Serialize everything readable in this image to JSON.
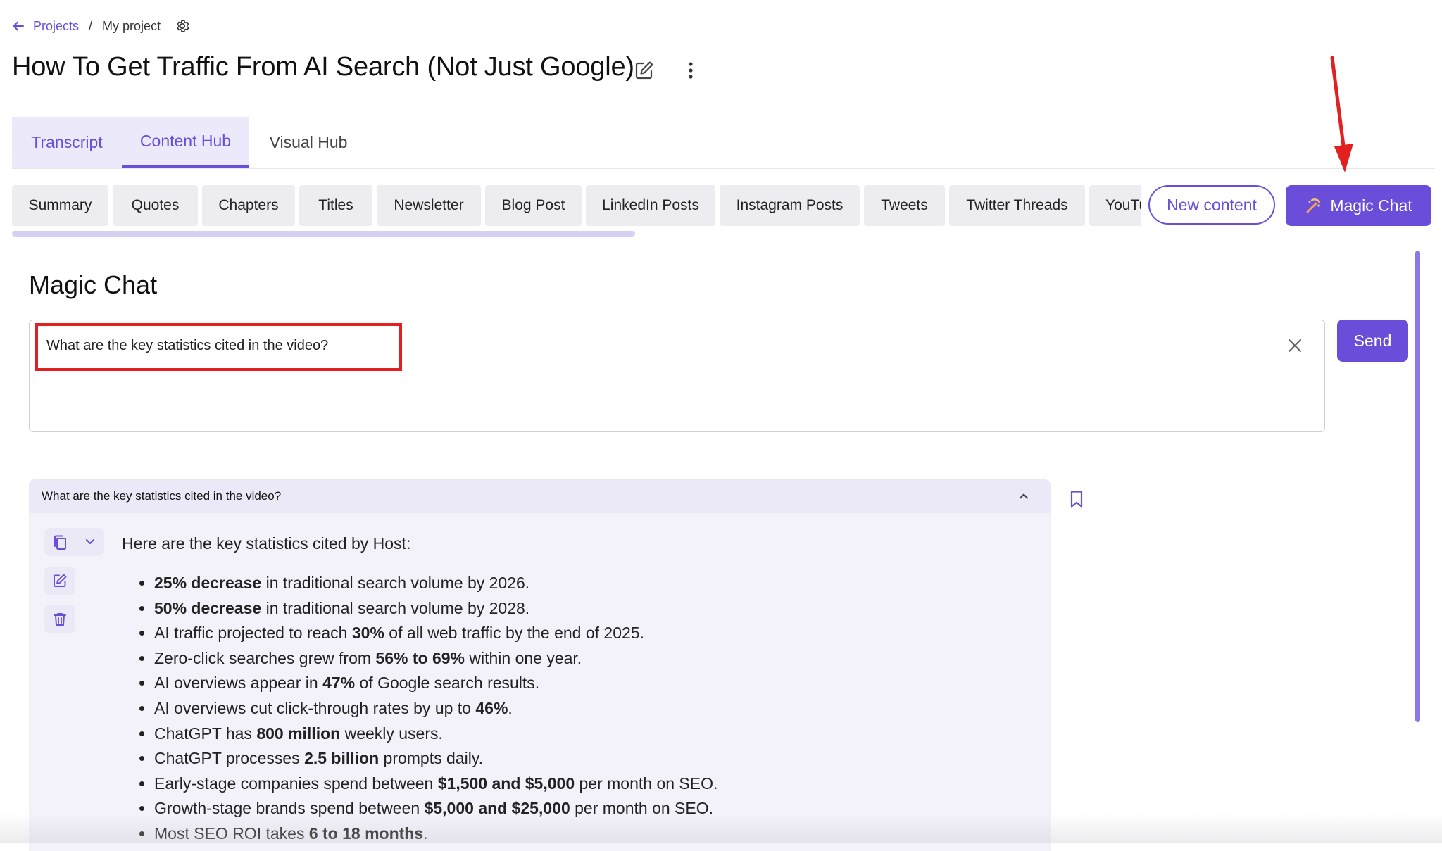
{
  "breadcrumb": {
    "back_icon": "arrow-left-icon",
    "projects": "Projects",
    "separator": "/",
    "current": "My project",
    "settings_icon": "gear-icon"
  },
  "title": "How To Get Traffic From AI Search (Not Just Google)",
  "title_actions": {
    "edit_icon": "edit-icon",
    "more_icon": "more-vertical-icon"
  },
  "main_tabs": [
    {
      "label": "Transcript"
    },
    {
      "label": "Content Hub",
      "active": true
    },
    {
      "label": "Visual Hub"
    }
  ],
  "sub_tabs": [
    {
      "label": "Summary"
    },
    {
      "label": "Quotes"
    },
    {
      "label": "Chapters"
    },
    {
      "label": "Titles"
    },
    {
      "label": "Newsletter"
    },
    {
      "label": "Blog Post"
    },
    {
      "label": "LinkedIn Posts"
    },
    {
      "label": "Instagram Posts"
    },
    {
      "label": "Tweets"
    },
    {
      "label": "Twitter Threads"
    },
    {
      "label": "YouTul"
    }
  ],
  "actions": {
    "new_content": "New content",
    "magic_chat": "Magic Chat",
    "magic_icon": "magic-wand-icon"
  },
  "section_title": "Magic Chat",
  "chat": {
    "input_value": "What are the key statistics cited in the video?",
    "clear_icon": "close-icon",
    "send_label": "Send"
  },
  "response": {
    "question": "What are the key statistics cited in the video?",
    "intro": "Here are the key statistics cited by Host:",
    "tools": {
      "copy_icon": "copy-icon",
      "dropdown_icon": "chevron-down-icon",
      "edit_icon": "edit-icon",
      "delete_icon": "trash-icon",
      "collapse_icon": "chevron-up-icon",
      "bookmark_icon": "bookmark-icon"
    },
    "items": [
      {
        "pre": "",
        "bold": "25% decrease",
        "post": " in traditional search volume by 2026."
      },
      {
        "pre": "",
        "bold": "50% decrease",
        "post": " in traditional search volume by 2028."
      },
      {
        "pre": "AI traffic projected to reach ",
        "bold": "30%",
        "post": " of all web traffic by the end of 2025."
      },
      {
        "pre": "Zero-click searches grew from ",
        "bold": "56% to 69%",
        "post": " within one year."
      },
      {
        "pre": "AI overviews appear in ",
        "bold": "47%",
        "post": " of Google search results."
      },
      {
        "pre": "AI overviews cut click-through rates by up to ",
        "bold": "46%",
        "post": "."
      },
      {
        "pre": "ChatGPT has ",
        "bold": "800 million",
        "post": " weekly users."
      },
      {
        "pre": "ChatGPT processes ",
        "bold": "2.5 billion",
        "post": " prompts daily."
      },
      {
        "pre": "Early-stage companies spend between ",
        "bold": "$1,500 and $5,000",
        "post": " per month on SEO."
      },
      {
        "pre": "Growth-stage brands spend between ",
        "bold": "$5,000 and $25,000",
        "post": " per month on SEO."
      },
      {
        "pre": "Most SEO ROI takes ",
        "bold": "6 to 18 months",
        "post": "."
      }
    ]
  },
  "colors": {
    "accent": "#6a4dd9",
    "accent_light": "#ece9fb",
    "annotation_red": "#e22020"
  }
}
